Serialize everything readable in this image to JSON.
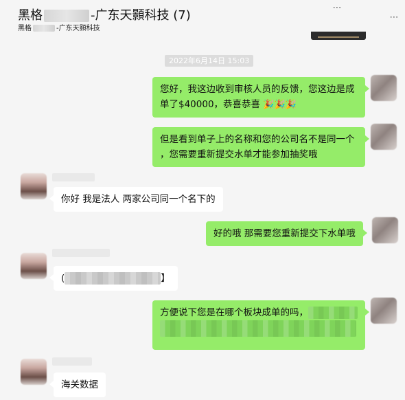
{
  "header": {
    "title_prefix": "黑格",
    "title_suffix": "-广东天顥科技 (7)",
    "subtitle_prefix": "黑格",
    "subtitle_suffix": "-广东天顥科技"
  },
  "timestamp": "2022年6月14日 15:03",
  "messages": [
    {
      "side": "right",
      "line1": "您好，我这边收到审核人员的反馈，您这边是成",
      "line2": "单了$40000，恭喜恭喜",
      "emoji": "🎉🎉🎉"
    },
    {
      "side": "right",
      "line1": "但是看到单子上的名称和您的公司名不是同一个",
      "line2": "，您需要重新提交水单才能参加抽奖哦"
    },
    {
      "side": "left",
      "text": "你好 我是法人 两家公司同一个名下的"
    },
    {
      "side": "right",
      "text": "好的哦 那需要您重新提交下水单哦"
    },
    {
      "side": "left",
      "prefix": "(",
      "suffix": "】"
    },
    {
      "side": "right",
      "text": "方便说下您是在哪个板块成单的吗，"
    },
    {
      "side": "left",
      "text": "海关数据"
    }
  ],
  "icons": {
    "more": "more-icon",
    "close": "close-icon"
  }
}
